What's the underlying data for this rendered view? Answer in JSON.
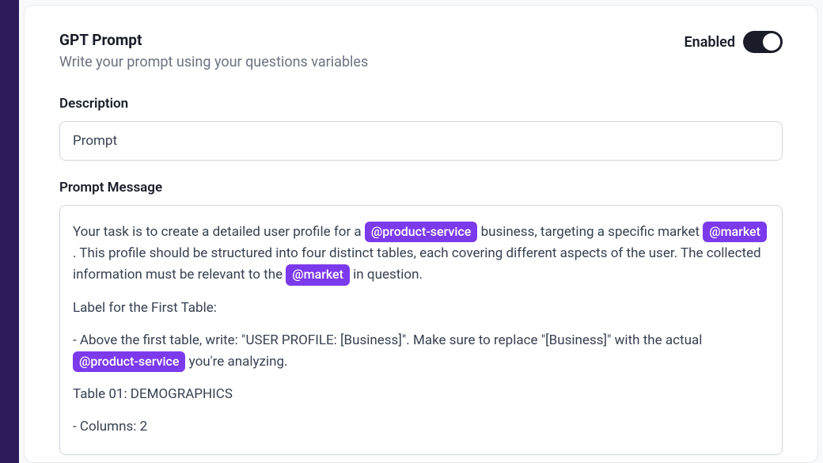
{
  "header": {
    "title": "GPT Prompt",
    "subtitle": "Write your prompt using your questions variables"
  },
  "toggle": {
    "label": "Enabled",
    "value": true
  },
  "description": {
    "label": "Description",
    "value": "Prompt"
  },
  "prompt": {
    "label": "Prompt Message",
    "tags": {
      "product_service": "@product-service",
      "market": "@market"
    },
    "text": {
      "p1_a": "Your task is to create a detailed user profile for a ",
      "p1_b": " business, targeting a specific market ",
      "p1_c": " . This profile should be structured into four distinct tables, each covering different aspects of the user. The collected information must be relevant to the ",
      "p1_d": " in question.",
      "p2": "Label for the First Table:",
      "p3_a": "- Above the first table, write: \"USER PROFILE: [Business]\". Make sure to replace \"[Business]\" with the actual ",
      "p3_b": " you're analyzing.",
      "p4": "Table 01: DEMOGRAPHICS",
      "p5": "- Columns: 2"
    }
  }
}
